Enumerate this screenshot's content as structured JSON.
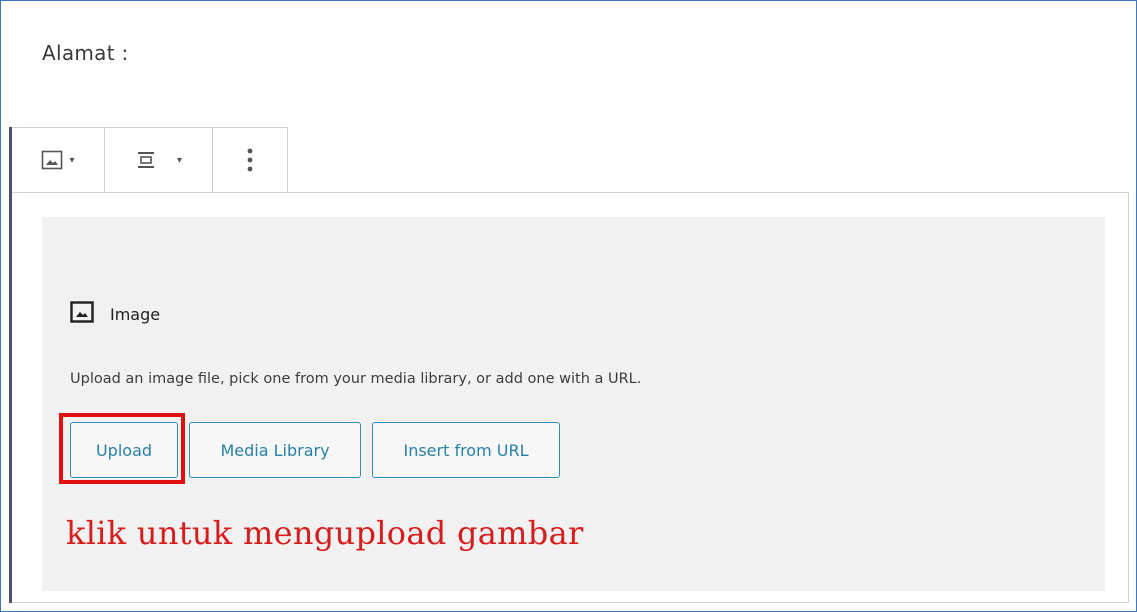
{
  "form": {
    "address_label": "Alamat :"
  },
  "toolbar": {
    "icons": [
      "image-block-icon",
      "align-center-icon",
      "more-options-icon"
    ],
    "carets": [
      "▾",
      "▾"
    ]
  },
  "image_block": {
    "title": "Image",
    "instructions": "Upload an image file, pick one from your media library, or add one with a URL.",
    "buttons": {
      "upload": "Upload",
      "media_library": "Media Library",
      "insert_url": "Insert from URL"
    }
  },
  "annotation": {
    "text": "klik untuk mengupload gambar",
    "color": "#d81c1c"
  },
  "colors": {
    "frame": "#3e78c2",
    "button_border": "#2f8fb5",
    "button_text": "#2781a9",
    "highlight": "#e01010"
  }
}
